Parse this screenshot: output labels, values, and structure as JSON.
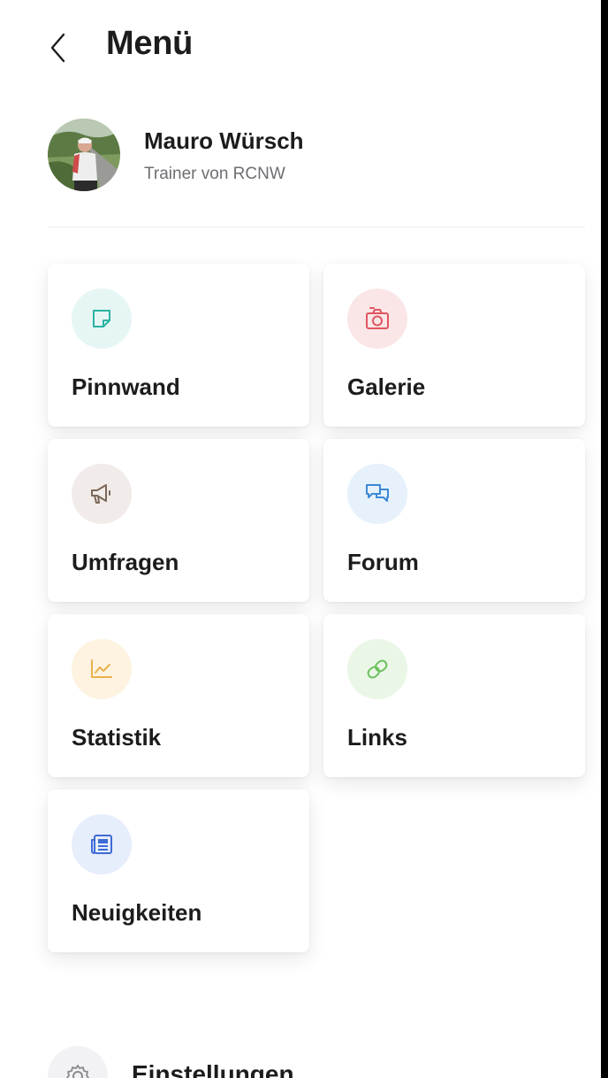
{
  "header": {
    "title": "Menü",
    "back_icon": "chevron-left-icon"
  },
  "profile": {
    "name": "Mauro Würsch",
    "role": "Trainer von RCNW"
  },
  "tiles": [
    {
      "label": "Pinnwand",
      "icon": "sticky-note-icon",
      "color": "#2bb3a3",
      "bg": "#e6f6f4"
    },
    {
      "label": "Galerie",
      "icon": "camera-icon",
      "color": "#e05561",
      "bg": "#fbe6e7"
    },
    {
      "label": "Umfragen",
      "icon": "megaphone-icon",
      "color": "#7a6858",
      "bg": "#f1ecea"
    },
    {
      "label": "Forum",
      "icon": "chat-bubbles-icon",
      "color": "#3b8ad6",
      "bg": "#e6f1fb"
    },
    {
      "label": "Statistik",
      "icon": "line-chart-icon",
      "color": "#eab14c",
      "bg": "#fdf3e0"
    },
    {
      "label": "Links",
      "icon": "link-icon",
      "color": "#6cc05e",
      "bg": "#eaf7e7"
    },
    {
      "label": "Neuigkeiten",
      "icon": "newspaper-icon",
      "color": "#3e6bd6",
      "bg": "#e6edfb"
    }
  ],
  "settings": {
    "label": "Einstellungen",
    "icon": "gear-icon"
  }
}
